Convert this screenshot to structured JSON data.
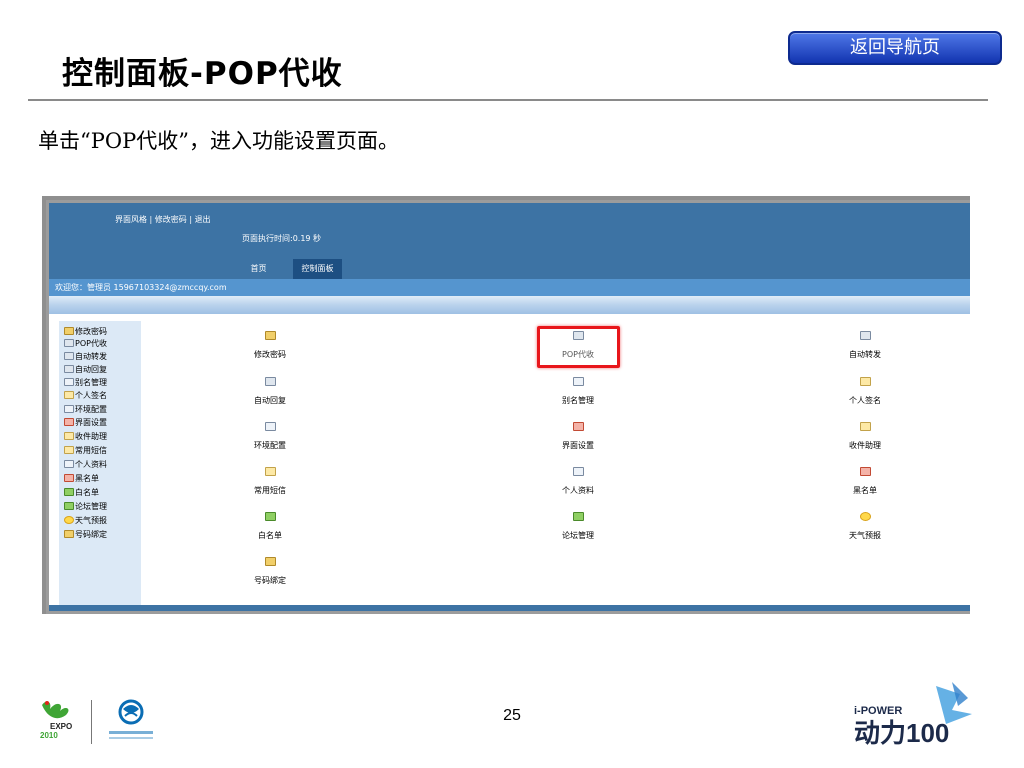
{
  "slide": {
    "title": "控制面板-POP代收",
    "back_button": "返回导航页",
    "instruction": "单击“POP代收”，进入功能设置页面。",
    "page_number": "25"
  },
  "app": {
    "top_links": [
      "界面风格",
      "修改密码",
      "退出"
    ],
    "exec_time": "页面执行时间:0.19 秒",
    "tabs": [
      "首页",
      "控制面板"
    ],
    "welcome": "欢迎您：管理员 15967103324@zmccqy.com"
  },
  "sidebar": {
    "items": [
      {
        "label": "修改密码",
        "icon": "key-icon"
      },
      {
        "label": "POP代收",
        "icon": "mailbox-icon"
      },
      {
        "label": "自动转发",
        "icon": "forward-icon"
      },
      {
        "label": "自动回复",
        "icon": "reply-icon"
      },
      {
        "label": "别名管理",
        "icon": "alias-icon"
      },
      {
        "label": "个人签名",
        "icon": "signature-icon"
      },
      {
        "label": "环境配置",
        "icon": "config-icon"
      },
      {
        "label": "界面设置",
        "icon": "interface-icon"
      },
      {
        "label": "收件助理",
        "icon": "assistant-icon"
      },
      {
        "label": "常用短信",
        "icon": "folder-icon"
      },
      {
        "label": "个人资料",
        "icon": "profile-icon"
      },
      {
        "label": "黑名单",
        "icon": "blacklist-icon"
      },
      {
        "label": "白名单",
        "icon": "whitelist-icon"
      },
      {
        "label": "论坛管理",
        "icon": "forum-icon"
      },
      {
        "label": "天气预报",
        "icon": "sun-icon"
      },
      {
        "label": "号码绑定",
        "icon": "phone-bind-icon"
      }
    ]
  },
  "grid": {
    "items": [
      {
        "label": "修改密码",
        "icon": "key-icon"
      },
      {
        "label": "POP代收",
        "icon": "mailbox-icon"
      },
      {
        "label": "自动转发",
        "icon": "forward-icon"
      },
      {
        "label": "自动回复",
        "icon": "reply-icon"
      },
      {
        "label": "别名管理",
        "icon": "alias-icon"
      },
      {
        "label": "个人签名",
        "icon": "signature-icon"
      },
      {
        "label": "环境配置",
        "icon": "config-icon"
      },
      {
        "label": "界面设置",
        "icon": "interface-icon"
      },
      {
        "label": "收件助理",
        "icon": "assistant-icon"
      },
      {
        "label": "常用短信",
        "icon": "folder-icon"
      },
      {
        "label": "个人资料",
        "icon": "profile-icon"
      },
      {
        "label": "黑名单",
        "icon": "blacklist-icon"
      },
      {
        "label": "白名单",
        "icon": "whitelist-icon"
      },
      {
        "label": "论坛管理",
        "icon": "forum-icon"
      },
      {
        "label": "天气预报",
        "icon": "sun-icon"
      },
      {
        "label": "号码绑定",
        "icon": "phone-bind-icon"
      }
    ],
    "selected": "POP代收"
  },
  "footer": {
    "logo_left_text": "EXPO",
    "logo_right_text": "i-POWER"
  },
  "colors": {
    "app_header": "#3d73a4",
    "welcome_bar": "#5595cf",
    "sidebar_bg": "#dce9f6",
    "highlight": "#e8161b",
    "back_button": "#1f44c4"
  }
}
